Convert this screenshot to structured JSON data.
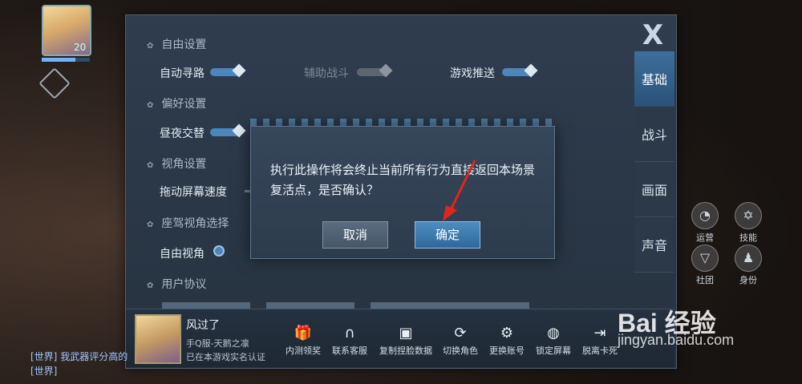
{
  "hud": {
    "level": "20"
  },
  "settings": {
    "sections": [
      "自由设置",
      "偏好设置",
      "视角设置",
      "座驾视角选择",
      "用户协议"
    ],
    "auto_path": "自动寻路",
    "assist_battle": "辅助战斗",
    "game_push": "游戏推送",
    "day_night": "昼夜交替",
    "drag_speed": "拖动屏幕速度",
    "free_view": "自由视角"
  },
  "tabs": [
    {
      "label": "基础",
      "active": true
    },
    {
      "label": "战斗",
      "active": false
    },
    {
      "label": "画面",
      "active": false
    },
    {
      "label": "声音",
      "active": false
    }
  ],
  "close_label": "X",
  "player": {
    "name": "风过了",
    "server": "手Q服-天鹅之凛",
    "verify": "已在本游戏实名认证"
  },
  "footer_buttons": [
    {
      "label": "内测领奖",
      "icon": "gift-icon"
    },
    {
      "label": "联系客服",
      "icon": "headset-icon"
    },
    {
      "label": "复制捏脸数据",
      "icon": "save-icon"
    },
    {
      "label": "切换角色",
      "icon": "switch-user-icon"
    },
    {
      "label": "更换账号",
      "icon": "robot-icon"
    },
    {
      "label": "锁定屏幕",
      "icon": "lock-icon"
    },
    {
      "label": "脱离卡死",
      "icon": "exit-icon"
    }
  ],
  "dialog": {
    "message": "执行此操作将会终止当前所有行为直接返回本场景复活点，是否确认？",
    "cancel": "取消",
    "confirm": "确定"
  },
  "right_hud": [
    "运营",
    "技能",
    "社团",
    "身份"
  ],
  "chat": [
    {
      "channel": "[世界]",
      "text": "我武器评分高的"
    },
    {
      "channel": "[世界]",
      "text": ""
    }
  ],
  "watermark": {
    "brand": "Bai 经验",
    "url": "jingyan.baidu.com"
  },
  "colors": {
    "accent": "#4d86bd",
    "confirm": "#2f6899",
    "arrow": "#e0261c"
  }
}
